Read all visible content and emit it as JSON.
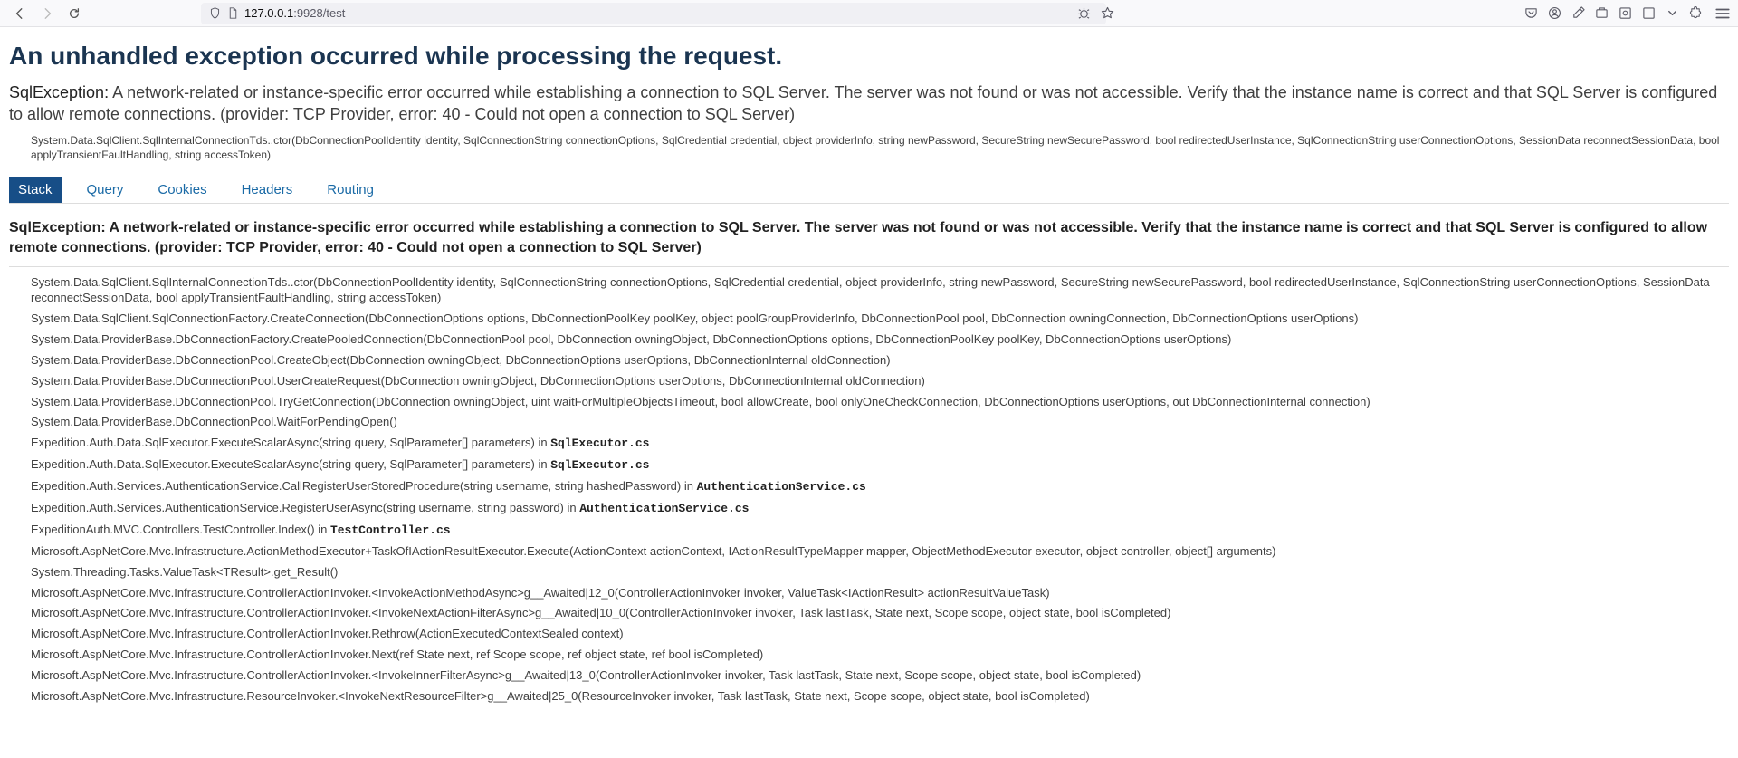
{
  "browser": {
    "url_display_prefix": "127.0.0.1",
    "url_display_suffix": ":9928/test"
  },
  "page": {
    "title": "An unhandled exception occurred while processing the request.",
    "exception_type": "SqlException:",
    "exception_message": "A network-related or instance-specific error occurred while establishing a connection to SQL Server. The server was not found or was not accessible. Verify that the instance name is correct and that SQL Server is configured to allow remote connections. (provider: TCP Provider, error: 40 - Could not open a connection to SQL Server)",
    "top_frame": "System.Data.SqlClient.SqlInternalConnectionTds..ctor(DbConnectionPoolIdentity identity, SqlConnectionString connectionOptions, SqlCredential credential, object providerInfo, string newPassword, SecureString newSecurePassword, bool redirectedUserInstance, SqlConnectionString userConnectionOptions, SessionData reconnectSessionData, bool applyTransientFaultHandling, string accessToken)"
  },
  "tabs": {
    "stack": "Stack",
    "query": "Query",
    "cookies": "Cookies",
    "headers": "Headers",
    "routing": "Routing"
  },
  "stack_section": {
    "header": "SqlException: A network-related or instance-specific error occurred while establishing a connection to SQL Server. The server was not found or was not accessible. Verify that the instance name is correct and that SQL Server is configured to allow remote connections. (provider: TCP Provider, error: 40 - Could not open a connection to SQL Server)",
    "frames": [
      {
        "text": "System.Data.SqlClient.SqlInternalConnectionTds..ctor(DbConnectionPoolIdentity identity, SqlConnectionString connectionOptions, SqlCredential credential, object providerInfo, string newPassword, SecureString newSecurePassword, bool redirectedUserInstance, SqlConnectionString userConnectionOptions, SessionData reconnectSessionData, bool applyTransientFaultHandling, string accessToken)",
        "file": ""
      },
      {
        "text": "System.Data.SqlClient.SqlConnectionFactory.CreateConnection(DbConnectionOptions options, DbConnectionPoolKey poolKey, object poolGroupProviderInfo, DbConnectionPool pool, DbConnection owningConnection, DbConnectionOptions userOptions)",
        "file": ""
      },
      {
        "text": "System.Data.ProviderBase.DbConnectionFactory.CreatePooledConnection(DbConnectionPool pool, DbConnection owningObject, DbConnectionOptions options, DbConnectionPoolKey poolKey, DbConnectionOptions userOptions)",
        "file": ""
      },
      {
        "text": "System.Data.ProviderBase.DbConnectionPool.CreateObject(DbConnection owningObject, DbConnectionOptions userOptions, DbConnectionInternal oldConnection)",
        "file": ""
      },
      {
        "text": "System.Data.ProviderBase.DbConnectionPool.UserCreateRequest(DbConnection owningObject, DbConnectionOptions userOptions, DbConnectionInternal oldConnection)",
        "file": ""
      },
      {
        "text": "System.Data.ProviderBase.DbConnectionPool.TryGetConnection(DbConnection owningObject, uint waitForMultipleObjectsTimeout, bool allowCreate, bool onlyOneCheckConnection, DbConnectionOptions userOptions, out DbConnectionInternal connection)",
        "file": ""
      },
      {
        "text": "System.Data.ProviderBase.DbConnectionPool.WaitForPendingOpen()",
        "file": ""
      },
      {
        "text": "Expedition.Auth.Data.SqlExecutor.ExecuteScalarAsync(string query, SqlParameter[] parameters) in ",
        "file": "SqlExecutor.cs"
      },
      {
        "text": "Expedition.Auth.Data.SqlExecutor.ExecuteScalarAsync(string query, SqlParameter[] parameters) in ",
        "file": "SqlExecutor.cs"
      },
      {
        "text": "Expedition.Auth.Services.AuthenticationService.CallRegisterUserStoredProcedure(string username, string hashedPassword) in ",
        "file": "AuthenticationService.cs"
      },
      {
        "text": "Expedition.Auth.Services.AuthenticationService.RegisterUserAsync(string username, string password) in ",
        "file": "AuthenticationService.cs"
      },
      {
        "text": "ExpeditionAuth.MVC.Controllers.TestController.Index() in ",
        "file": "TestController.cs"
      },
      {
        "text": "Microsoft.AspNetCore.Mvc.Infrastructure.ActionMethodExecutor+TaskOfIActionResultExecutor.Execute(ActionContext actionContext, IActionResultTypeMapper mapper, ObjectMethodExecutor executor, object controller, object[] arguments)",
        "file": ""
      },
      {
        "text": "System.Threading.Tasks.ValueTask<TResult>.get_Result()",
        "file": ""
      },
      {
        "text": "Microsoft.AspNetCore.Mvc.Infrastructure.ControllerActionInvoker.<InvokeActionMethodAsync>g__Awaited|12_0(ControllerActionInvoker invoker, ValueTask<IActionResult> actionResultValueTask)",
        "file": ""
      },
      {
        "text": "Microsoft.AspNetCore.Mvc.Infrastructure.ControllerActionInvoker.<InvokeNextActionFilterAsync>g__Awaited|10_0(ControllerActionInvoker invoker, Task lastTask, State next, Scope scope, object state, bool isCompleted)",
        "file": ""
      },
      {
        "text": "Microsoft.AspNetCore.Mvc.Infrastructure.ControllerActionInvoker.Rethrow(ActionExecutedContextSealed context)",
        "file": ""
      },
      {
        "text": "Microsoft.AspNetCore.Mvc.Infrastructure.ControllerActionInvoker.Next(ref State next, ref Scope scope, ref object state, ref bool isCompleted)",
        "file": ""
      },
      {
        "text": "Microsoft.AspNetCore.Mvc.Infrastructure.ControllerActionInvoker.<InvokeInnerFilterAsync>g__Awaited|13_0(ControllerActionInvoker invoker, Task lastTask, State next, Scope scope, object state, bool isCompleted)",
        "file": ""
      },
      {
        "text": "Microsoft.AspNetCore.Mvc.Infrastructure.ResourceInvoker.<InvokeNextResourceFilter>g__Awaited|25_0(ResourceInvoker invoker, Task lastTask, State next, Scope scope, object state, bool isCompleted)",
        "file": ""
      }
    ]
  }
}
